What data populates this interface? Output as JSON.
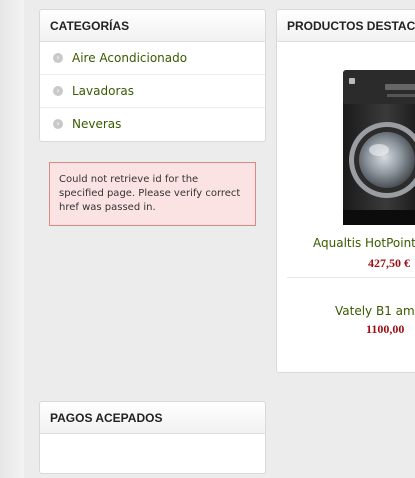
{
  "categories": {
    "title": "CATEGORÍAS",
    "items": [
      {
        "label": "Aire Acondicionado"
      },
      {
        "label": "Lavadoras"
      },
      {
        "label": "Neveras"
      }
    ]
  },
  "error": {
    "message": "Could not retrieve id for the specified page. Please verify correct href was passed in."
  },
  "featured": {
    "title": "PRODUCTOS DESTACADOS",
    "products": [
      {
        "name": "Aqualtis HotPoint",
        "price": "427,50 €"
      },
      {
        "name": "Vately B1 am",
        "price": "1100,00"
      }
    ]
  },
  "payments": {
    "title": "PAGOS ACEPADOS"
  },
  "colors": {
    "link": "#3a5a00",
    "price": "#9b0d14",
    "error_bg": "#fbe3e4",
    "error_border": "#d88a84"
  },
  "icons": {
    "bullet": "circle-bullet-icon"
  }
}
